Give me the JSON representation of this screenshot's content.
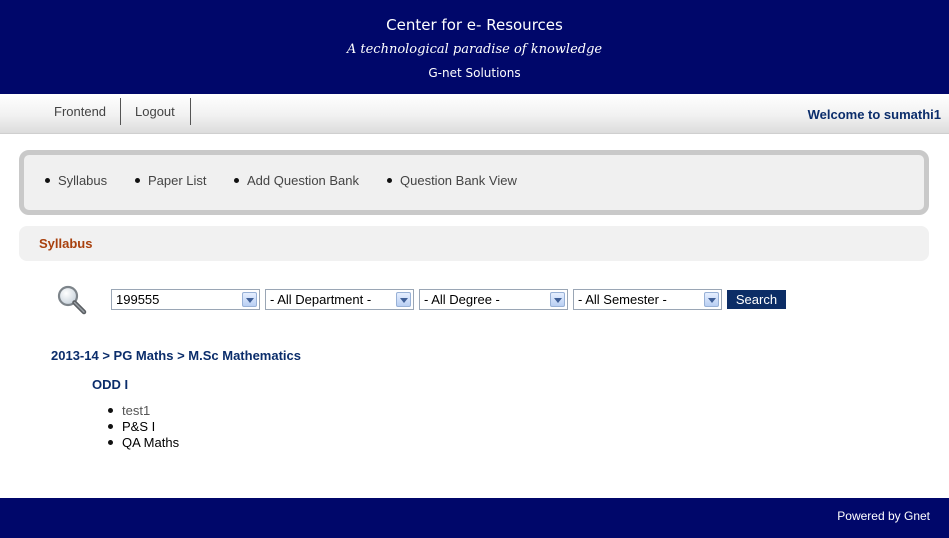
{
  "header": {
    "title": "Center for e- Resources",
    "tagline": "A technological paradise of knowledge",
    "company": "G-net Solutions"
  },
  "topnav": {
    "items": [
      {
        "label": "Frontend"
      },
      {
        "label": "Logout"
      }
    ],
    "welcome": "Welcome to sumathi1"
  },
  "submenu": {
    "items": [
      {
        "label": "Syllabus"
      },
      {
        "label": "Paper List"
      },
      {
        "label": "Add Question Bank"
      },
      {
        "label": "Question Bank View"
      }
    ]
  },
  "section": {
    "title": "Syllabus"
  },
  "filters": {
    "code": "199555",
    "department": "- All Department -",
    "degree": "- All Degree -",
    "semester": "- All Semester -",
    "search_label": "Search"
  },
  "results": {
    "breadcrumb": "2013-14 > PG Maths > M.Sc Mathematics",
    "semester": "ODD I",
    "subjects": [
      "test1",
      "P&S I",
      "QA Maths"
    ]
  },
  "footer": {
    "powered": "Powered by Gnet"
  },
  "colors": {
    "header_bg": "#00076a",
    "accent_text": "#0b2d6b",
    "section_title": "#a8400d",
    "button_bg": "#0c2d66"
  }
}
